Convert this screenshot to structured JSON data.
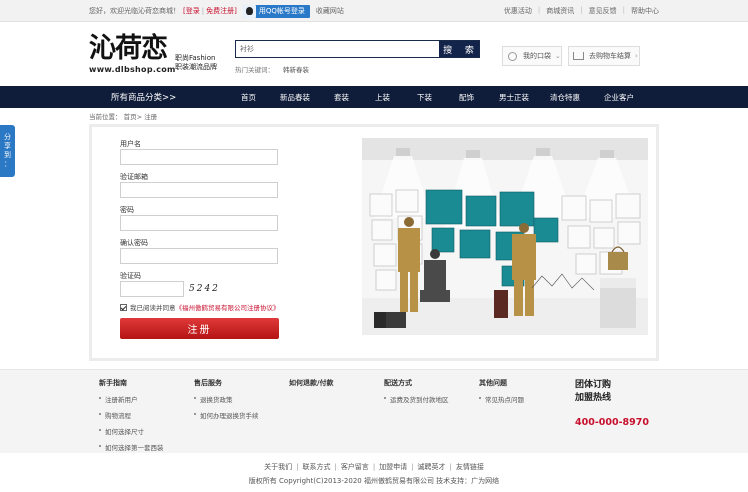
{
  "topbar": {
    "welcome": "您好，欢迎光临沁荷恋商城！",
    "login": "[登录",
    "register": "免费注册]",
    "qq_login": "用QQ帐号登录",
    "favorite": "收藏网站",
    "links": [
      "优惠活动",
      "商城资讯",
      "意见反馈",
      "帮助中心"
    ]
  },
  "logo": {
    "name": "沁荷恋",
    "slogan_line1": "职尚Fashion",
    "slogan_line2": "职装潮流品牌",
    "url": "www.dlbshop.com"
  },
  "search": {
    "value": "衬衫",
    "button": "搜 索",
    "hot_label": "热门关键词：",
    "hot_keyword": "韩新春装"
  },
  "user": {
    "my_account": "我的口袋",
    "cart": "去购物车结算"
  },
  "nav": {
    "categories": "所有商品分类>>",
    "items": [
      "首页",
      "新品春装",
      "套装",
      "上装",
      "下装",
      "配饰",
      "男士正装",
      "清仓特惠",
      "企业客户"
    ]
  },
  "breadcrumb": "当前位置： 首页> 注册",
  "side_tab": [
    "分",
    "享",
    "到",
    "："
  ],
  "form": {
    "username_label": "用户名",
    "email_label": "验证邮箱",
    "password_label": "密码",
    "confirm_label": "确认密码",
    "captcha_label": "验证码",
    "captcha_code": "5242",
    "agree_prefix": "我已阅读并同意",
    "agree_link": "《福州傲鹤贸易有限公司注册协议》",
    "register_button": "注册"
  },
  "footer": {
    "columns": [
      {
        "title": "新手指南",
        "items": [
          "注册新用户",
          "购物流程",
          "如何选择尺寸",
          "如何选择第一套西装"
        ]
      },
      {
        "title": "售后服务",
        "items": [
          "退换货政策",
          "如何办理退换货手续"
        ]
      },
      {
        "title": "如何退款/付款",
        "items": []
      },
      {
        "title": "配送方式",
        "items": [
          "运费及货到付款地区"
        ]
      },
      {
        "title": "其他问题",
        "items": [
          "常见热点问题"
        ]
      }
    ],
    "group_buy_1": "团体订购",
    "group_buy_2": "加盟热线",
    "hotline": "400-000-8970",
    "links": [
      "关于我们",
      "联系方式",
      "客户留言",
      "加盟申请",
      "诚聘英才",
      "友情链接"
    ],
    "copyright": "版权所有 Copyright(C)2013-2020 福州傲鹤贸易有限公司 技术支持：广为网络"
  },
  "colors": {
    "nav_bg": "#0f1c3a",
    "accent_red": "#c8102e",
    "qq_blue": "#2a79c8"
  }
}
